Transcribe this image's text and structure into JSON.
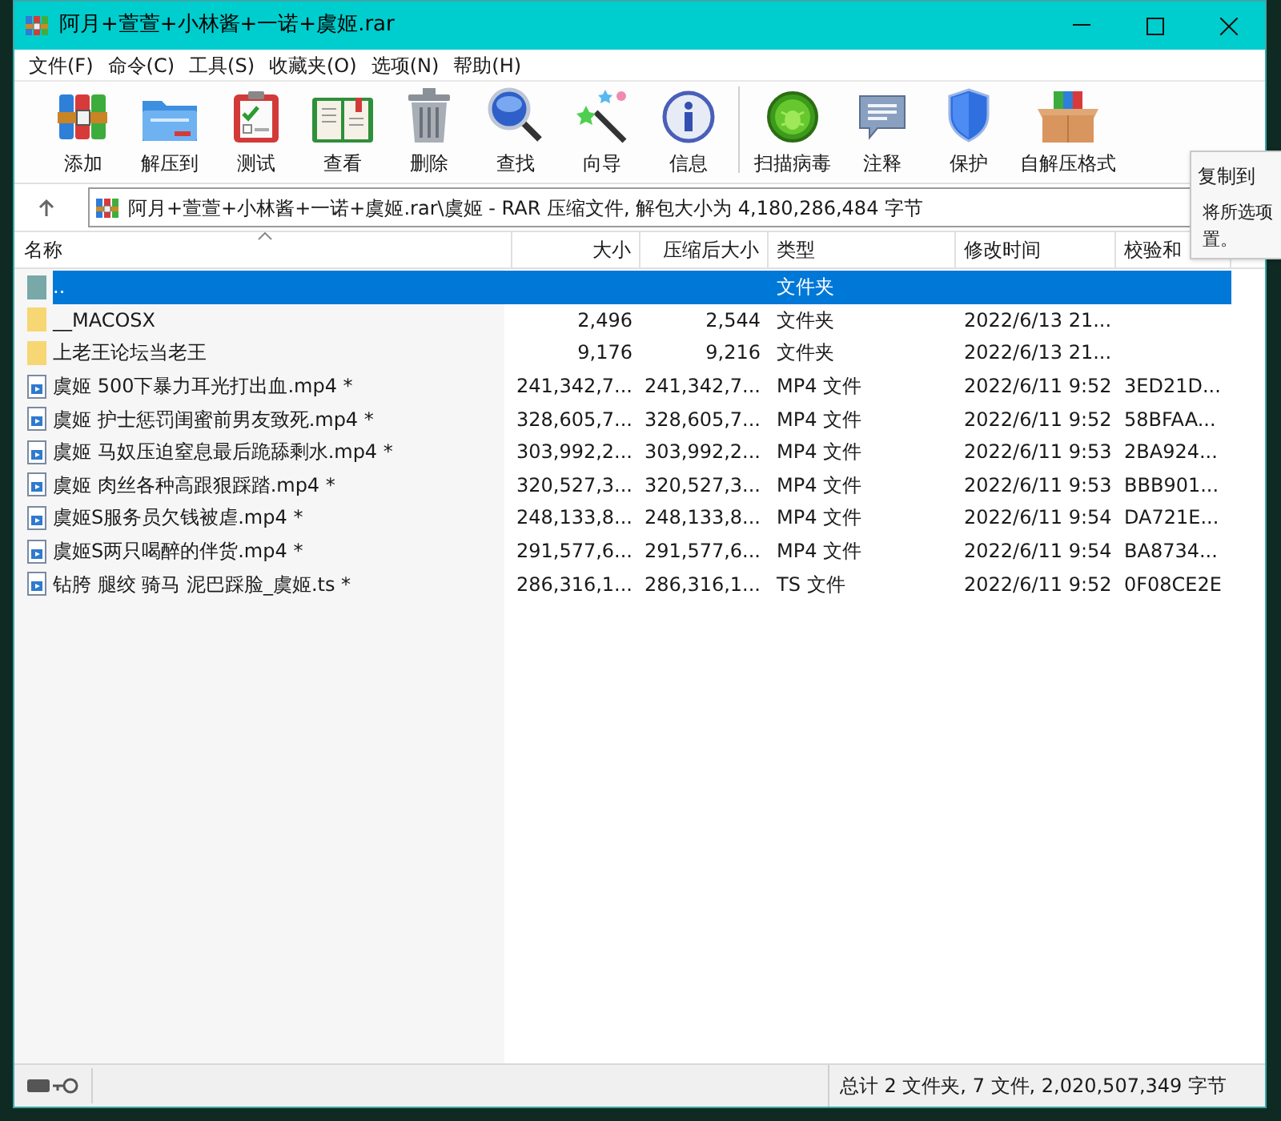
{
  "window": {
    "title": "阿月+萱萱+小林酱+一诺+虞姬.rar"
  },
  "menu": [
    "文件(F)",
    "命令(C)",
    "工具(S)",
    "收藏夹(O)",
    "选项(N)",
    "帮助(H)"
  ],
  "toolbar": [
    {
      "label": "添加"
    },
    {
      "label": "解压到"
    },
    {
      "label": "测试"
    },
    {
      "label": "查看"
    },
    {
      "label": "删除"
    },
    {
      "label": "查找"
    },
    {
      "label": "向导"
    },
    {
      "label": "信息"
    },
    {
      "label": "扫描病毒"
    },
    {
      "label": "注释"
    },
    {
      "label": "保护"
    },
    {
      "label": "自解压格式"
    }
  ],
  "address": {
    "path": "阿月+萱萱+小林酱+一诺+虞姬.rar\\虞姬 - RAR 压缩文件, 解包大小为 4,180,286,484 字节"
  },
  "tooltip": {
    "title": "复制到",
    "lines": [
      "将所选项",
      "置。"
    ]
  },
  "table": {
    "columns": [
      "名称",
      "大小",
      "压缩后大小",
      "类型",
      "修改时间",
      "校验和"
    ],
    "rows": [
      {
        "kind": "parent",
        "selected": true,
        "name": "..",
        "size": "",
        "packed": "",
        "type": "文件夹",
        "modified": "",
        "crc": ""
      },
      {
        "kind": "folder",
        "selected": false,
        "name": "__MACOSX",
        "size": "2,496",
        "packed": "2,544",
        "type": "文件夹",
        "modified": "2022/6/13 21...",
        "crc": ""
      },
      {
        "kind": "folder",
        "selected": false,
        "name": "上老王论坛当老王",
        "size": "9,176",
        "packed": "9,216",
        "type": "文件夹",
        "modified": "2022/6/13 21...",
        "crc": ""
      },
      {
        "kind": "file",
        "selected": false,
        "name": "虞姬 500下暴力耳光打出血.mp4 *",
        "size": "241,342,7...",
        "packed": "241,342,7...",
        "type": "MP4 文件",
        "modified": "2022/6/11 9:52",
        "crc": "3ED21D..."
      },
      {
        "kind": "file",
        "selected": false,
        "name": "虞姬 护士惩罚闺蜜前男友致死.mp4 *",
        "size": "328,605,7...",
        "packed": "328,605,7...",
        "type": "MP4 文件",
        "modified": "2022/6/11 9:52",
        "crc": "58BFAA..."
      },
      {
        "kind": "file",
        "selected": false,
        "name": "虞姬 马奴压迫窒息最后跪舔剩水.mp4 *",
        "size": "303,992,2...",
        "packed": "303,992,2...",
        "type": "MP4 文件",
        "modified": "2022/6/11 9:53",
        "crc": "2BA924..."
      },
      {
        "kind": "file",
        "selected": false,
        "name": "虞姬 肉丝各种高跟狠踩踏.mp4 *",
        "size": "320,527,3...",
        "packed": "320,527,3...",
        "type": "MP4 文件",
        "modified": "2022/6/11 9:53",
        "crc": "BBB901..."
      },
      {
        "kind": "file",
        "selected": false,
        "name": "虞姬S服务员欠钱被虐.mp4 *",
        "size": "248,133,8...",
        "packed": "248,133,8...",
        "type": "MP4 文件",
        "modified": "2022/6/11 9:54",
        "crc": "DA721E..."
      },
      {
        "kind": "file",
        "selected": false,
        "name": "虞姬S两只喝醉的伴货.mp4 *",
        "size": "291,577,6...",
        "packed": "291,577,6...",
        "type": "MP4 文件",
        "modified": "2022/6/11 9:54",
        "crc": "BA8734..."
      },
      {
        "kind": "file",
        "selected": false,
        "name": "钻胯 腿绞 骑马 泥巴踩脸_虞姬.ts *",
        "size": "286,316,1...",
        "packed": "286,316,1...",
        "type": "TS 文件",
        "modified": "2022/6/11 9:52",
        "crc": "0F08CE2E"
      }
    ]
  },
  "status_bar": {
    "text": "总计 2 文件夹, 7 文件, 2,020,507,349 字节"
  }
}
